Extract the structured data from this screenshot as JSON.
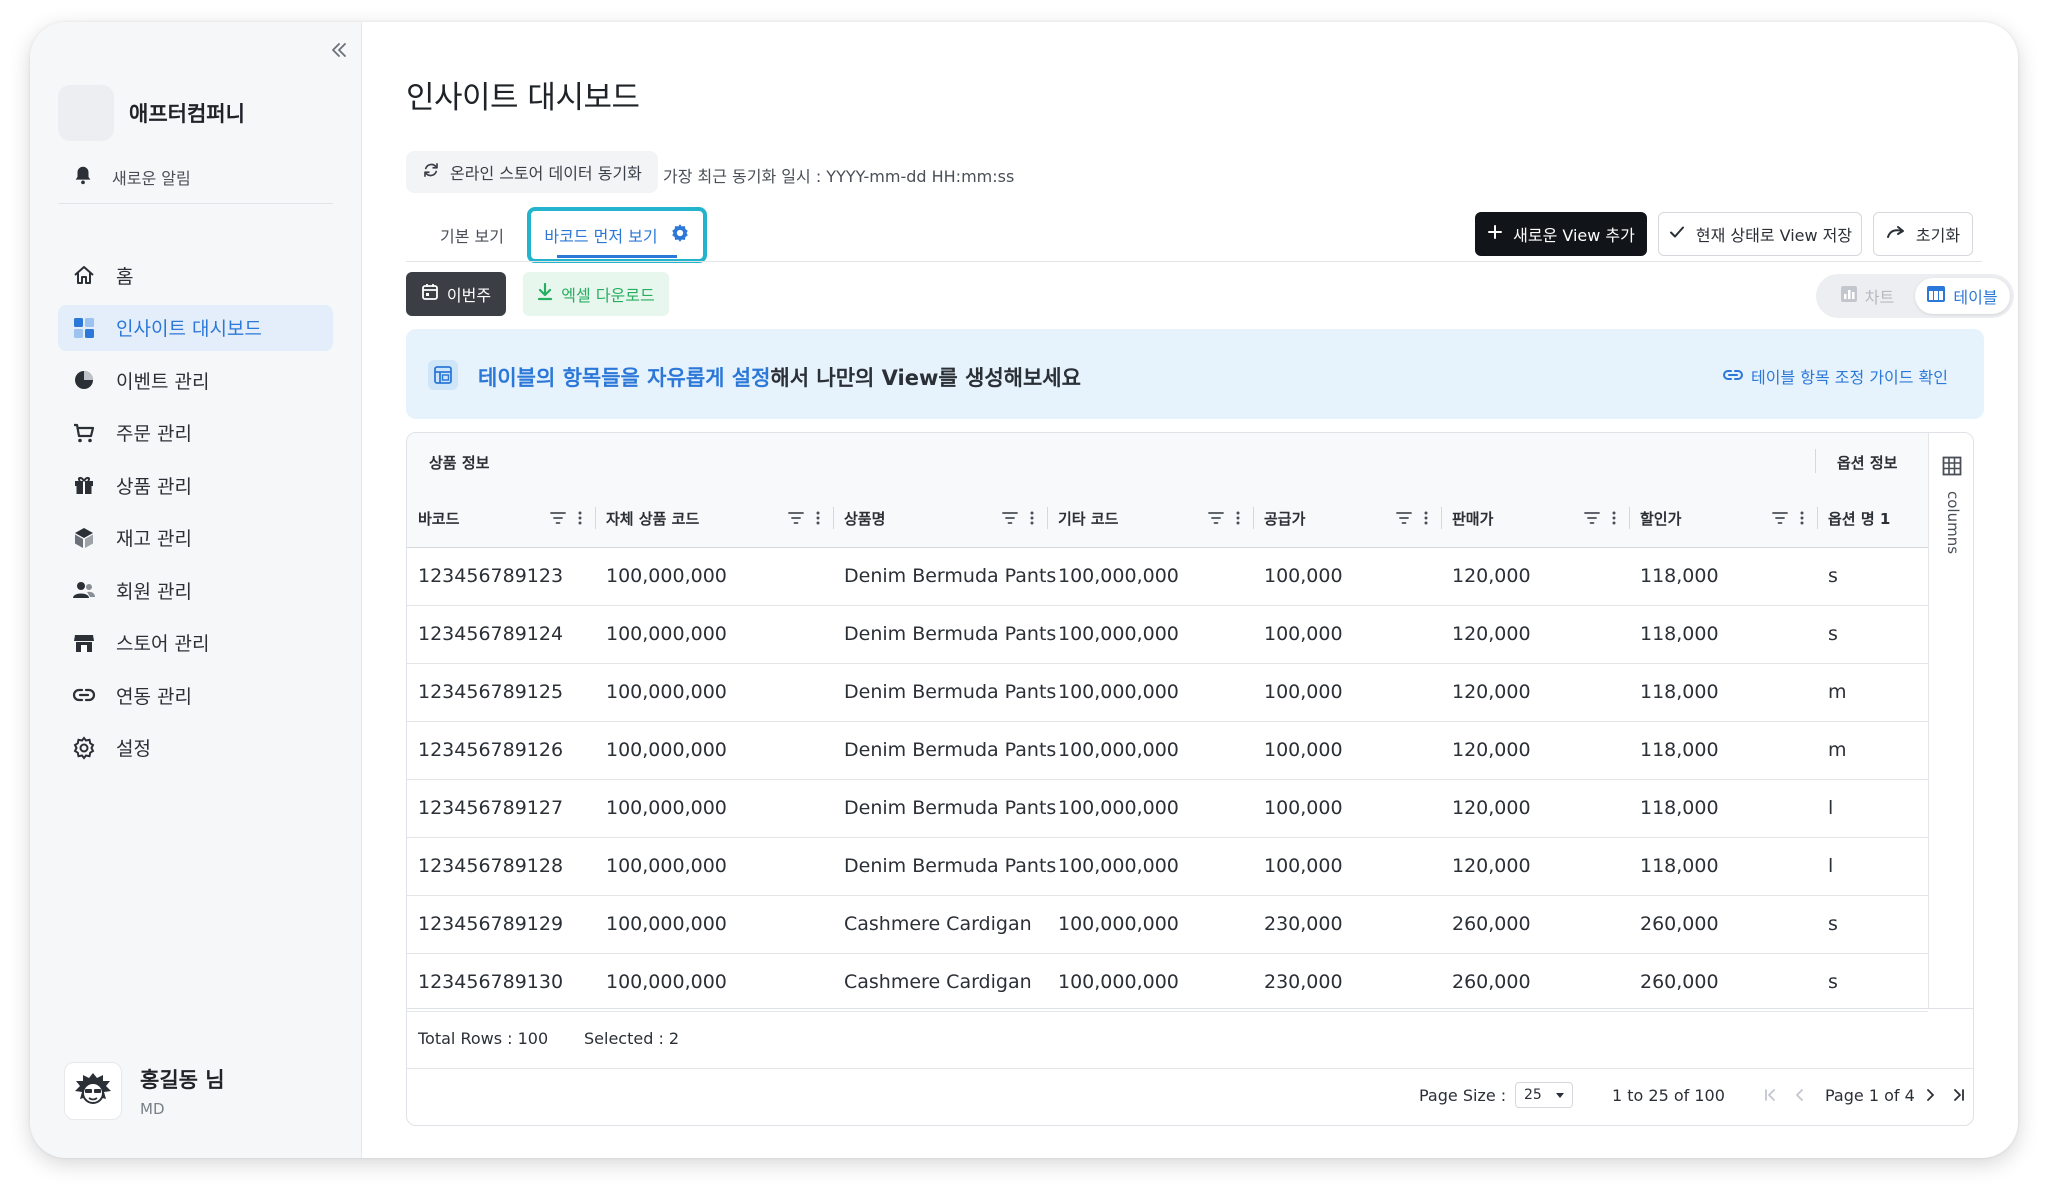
{
  "sidebar": {
    "company_name": "애프터컴퍼니",
    "notification_label": "새로운 알림",
    "items": [
      {
        "label": "홈",
        "icon": "home-icon"
      },
      {
        "label": "인사이트 대시보드",
        "icon": "dashboard-icon",
        "active": true
      },
      {
        "label": "이벤트 관리",
        "icon": "pie-chart-icon"
      },
      {
        "label": "주문 관리",
        "icon": "cart-icon"
      },
      {
        "label": "상품 관리",
        "icon": "gift-icon"
      },
      {
        "label": "재고 관리",
        "icon": "box-icon"
      },
      {
        "label": "회원 관리",
        "icon": "users-icon"
      },
      {
        "label": "스토어 관리",
        "icon": "store-icon"
      },
      {
        "label": "연동 관리",
        "icon": "link-icon"
      },
      {
        "label": "설정",
        "icon": "gear-icon"
      }
    ],
    "user": {
      "name": "홍길동 님",
      "role": "MD"
    }
  },
  "header": {
    "title": "인사이트 대시보드",
    "sync_button": "온라인 스토어 데이터 동기화",
    "sync_time": "가장 최근 동기화 일시 : YYYY-mm-dd HH:mm:ss"
  },
  "tabs": {
    "basic": "기본 보기",
    "barcode_first": "바코드 먼저 보기"
  },
  "actions": {
    "add_view": "새로운 View 추가",
    "save_view": "현재 상태로 View 저장",
    "reset": "초기화",
    "this_week": "이번주",
    "excel_download": "엑셀 다운로드",
    "view_chart": "차트",
    "view_table": "테이블"
  },
  "banner": {
    "highlight": "테이블의 항목들을 자유롭게 설정",
    "rest": "해서 나만의 View를 생성해보세요",
    "link": "테이블 항목 조정 가이드 확인"
  },
  "table": {
    "groups": {
      "product": "상품 정보",
      "option": "옵션 정보"
    },
    "columns": [
      "바코드",
      "자체 상품 코드",
      "상품명",
      "기타 코드",
      "공급가",
      "판매가",
      "할인가",
      "옵션 명 1"
    ],
    "rows": [
      [
        "123456789123",
        "100,000,000",
        "Denim Bermuda Pants",
        "100,000,000",
        "100,000",
        "120,000",
        "118,000",
        "s"
      ],
      [
        "123456789124",
        "100,000,000",
        "Denim Bermuda Pants",
        "100,000,000",
        "100,000",
        "120,000",
        "118,000",
        "s"
      ],
      [
        "123456789125",
        "100,000,000",
        "Denim Bermuda Pants",
        "100,000,000",
        "100,000",
        "120,000",
        "118,000",
        "m"
      ],
      [
        "123456789126",
        "100,000,000",
        "Denim Bermuda Pants",
        "100,000,000",
        "100,000",
        "120,000",
        "118,000",
        "m"
      ],
      [
        "123456789127",
        "100,000,000",
        "Denim Bermuda Pants",
        "100,000,000",
        "100,000",
        "120,000",
        "118,000",
        "l"
      ],
      [
        "123456789128",
        "100,000,000",
        "Denim Bermuda Pants",
        "100,000,000",
        "100,000",
        "120,000",
        "118,000",
        "l"
      ],
      [
        "123456789129",
        "100,000,000",
        "Cashmere Cardigan",
        "100,000,000",
        "230,000",
        "260,000",
        "260,000",
        "s"
      ],
      [
        "123456789130",
        "100,000,000",
        "Cashmere Cardigan",
        "100,000,000",
        "230,000",
        "260,000",
        "260,000",
        "s"
      ]
    ],
    "side_panel_label": "columns",
    "total_rows": "Total Rows : 100",
    "selected": "Selected : 2",
    "page_size_label": "Page Size :",
    "page_size_value": "25",
    "range": "1 to 25 of 100",
    "page": "Page 1 of 4"
  },
  "colors": {
    "accent": "#2c78d8",
    "highlight_border": "#24b3cc",
    "primary_button": "#111418",
    "excel_green": "#27ae60",
    "banner_bg": "#e6f3fd"
  }
}
